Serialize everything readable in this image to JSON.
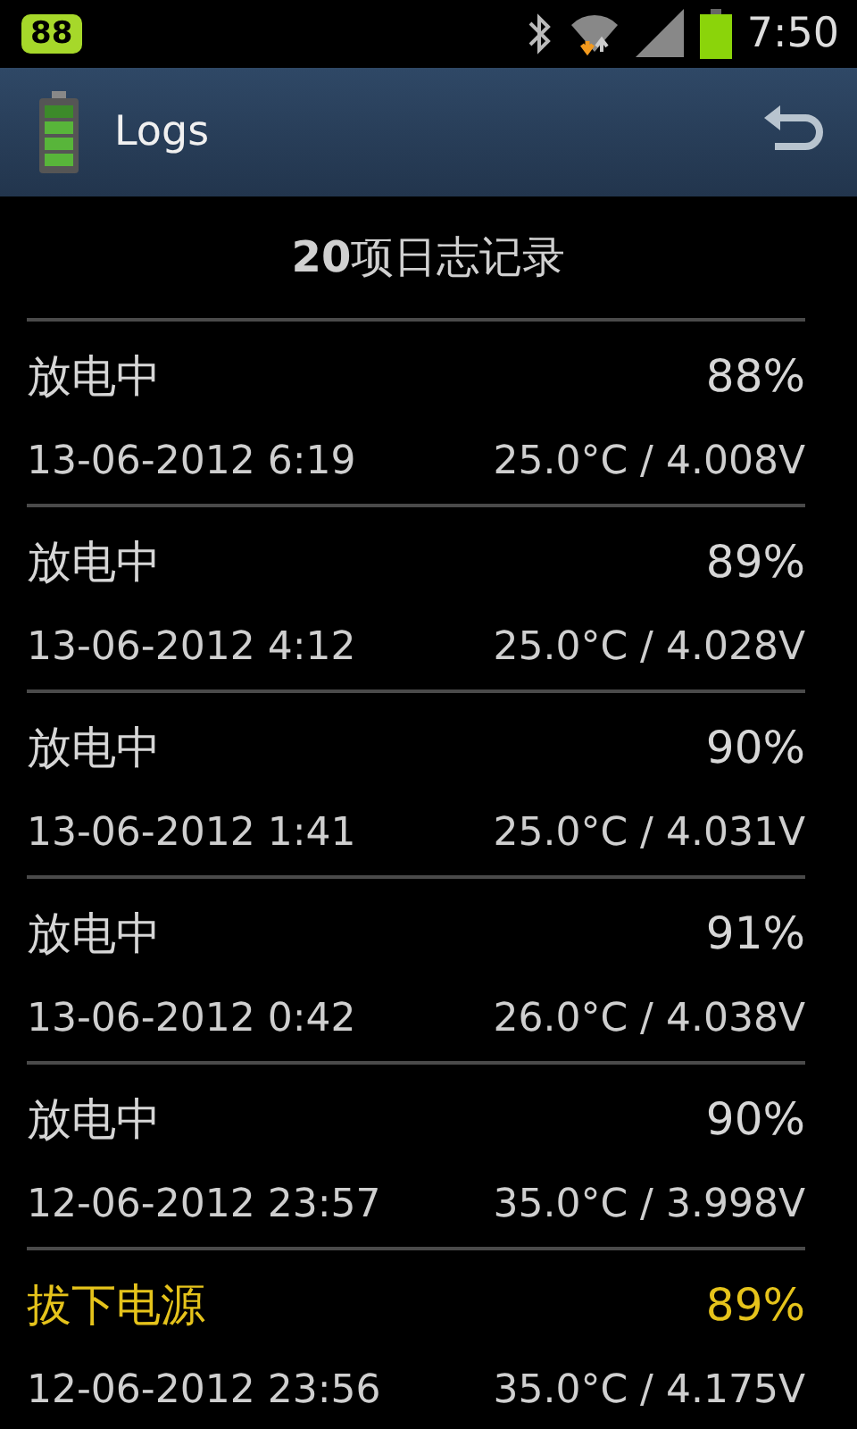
{
  "status_bar": {
    "battery_badge": "88",
    "time": "7:50"
  },
  "app_bar": {
    "title": "Logs"
  },
  "summary": "**20**项日志记录",
  "logs": [
    {
      "kind": "discharging",
      "state": "放电中",
      "percent": "88%",
      "datetime": "13-06-2012  6:19",
      "reading": "25.0°C / 4.008V"
    },
    {
      "kind": "discharging",
      "state": "放电中",
      "percent": "89%",
      "datetime": "13-06-2012  4:12",
      "reading": "25.0°C / 4.028V"
    },
    {
      "kind": "discharging",
      "state": "放电中",
      "percent": "90%",
      "datetime": "13-06-2012  1:41",
      "reading": "25.0°C / 4.031V"
    },
    {
      "kind": "discharging",
      "state": "放电中",
      "percent": "91%",
      "datetime": "13-06-2012  0:42",
      "reading": "26.0°C / 4.038V"
    },
    {
      "kind": "discharging",
      "state": "放电中",
      "percent": "90%",
      "datetime": "12-06-2012  23:57",
      "reading": "35.0°C / 3.998V"
    },
    {
      "kind": "unplugged",
      "state": "拔下电源",
      "percent": "89%",
      "datetime": "12-06-2012  23:56",
      "reading": "35.0°C / 4.175V"
    }
  ]
}
